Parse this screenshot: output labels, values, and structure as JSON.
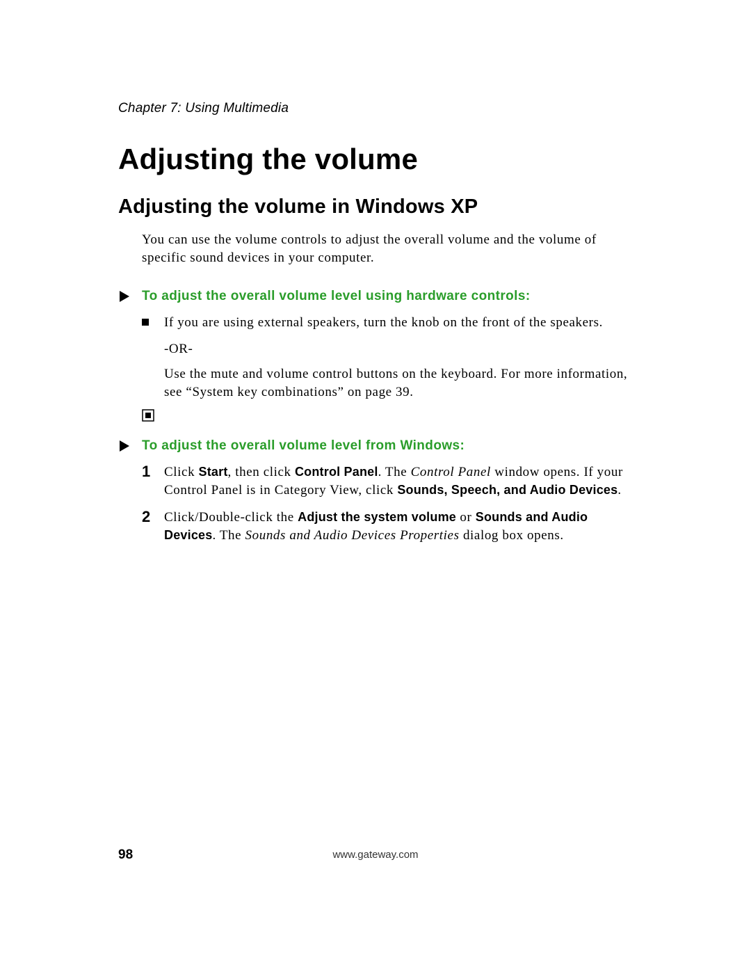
{
  "chapter": "Chapter 7: Using Multimedia",
  "h1": "Adjusting the volume",
  "h2": "Adjusting the volume in Windows XP",
  "intro": "You can use the volume controls to adjust the overall volume and the volume of specific sound devices in your computer.",
  "proc1": {
    "heading": "To adjust the overall volume level using hardware controls:",
    "bullet": "If you are using external speakers, turn the knob on the front of the speakers.",
    "or": "-OR-",
    "after_or": "Use the mute and volume control buttons on the keyboard. For more information, see “System key combinations” on page 39."
  },
  "proc2": {
    "heading": "To adjust the overall volume level from Windows:",
    "steps": [
      {
        "num": "1",
        "parts": [
          {
            "t": "Click ",
            "cls": ""
          },
          {
            "t": "Start",
            "cls": "bold-sans"
          },
          {
            "t": ", then click ",
            "cls": ""
          },
          {
            "t": "Control Panel",
            "cls": "bold-sans"
          },
          {
            "t": ". The ",
            "cls": ""
          },
          {
            "t": "Control Panel",
            "cls": "ital"
          },
          {
            "t": " window opens. If your Control Panel is in Category View, click ",
            "cls": ""
          },
          {
            "t": "Sounds, Speech, and Audio Devices",
            "cls": "bold-sans"
          },
          {
            "t": ".",
            "cls": ""
          }
        ]
      },
      {
        "num": "2",
        "parts": [
          {
            "t": "Click/Double-click the ",
            "cls": ""
          },
          {
            "t": "Adjust the system volume",
            "cls": "bold-sans"
          },
          {
            "t": " or ",
            "cls": ""
          },
          {
            "t": "Sounds and Audio Devices",
            "cls": "bold-sans"
          },
          {
            "t": ". The ",
            "cls": ""
          },
          {
            "t": "Sounds and Audio Devices Properties",
            "cls": "ital"
          },
          {
            "t": " dialog box opens.",
            "cls": ""
          }
        ]
      }
    ]
  },
  "footer": {
    "page": "98",
    "url": "www.gateway.com"
  }
}
